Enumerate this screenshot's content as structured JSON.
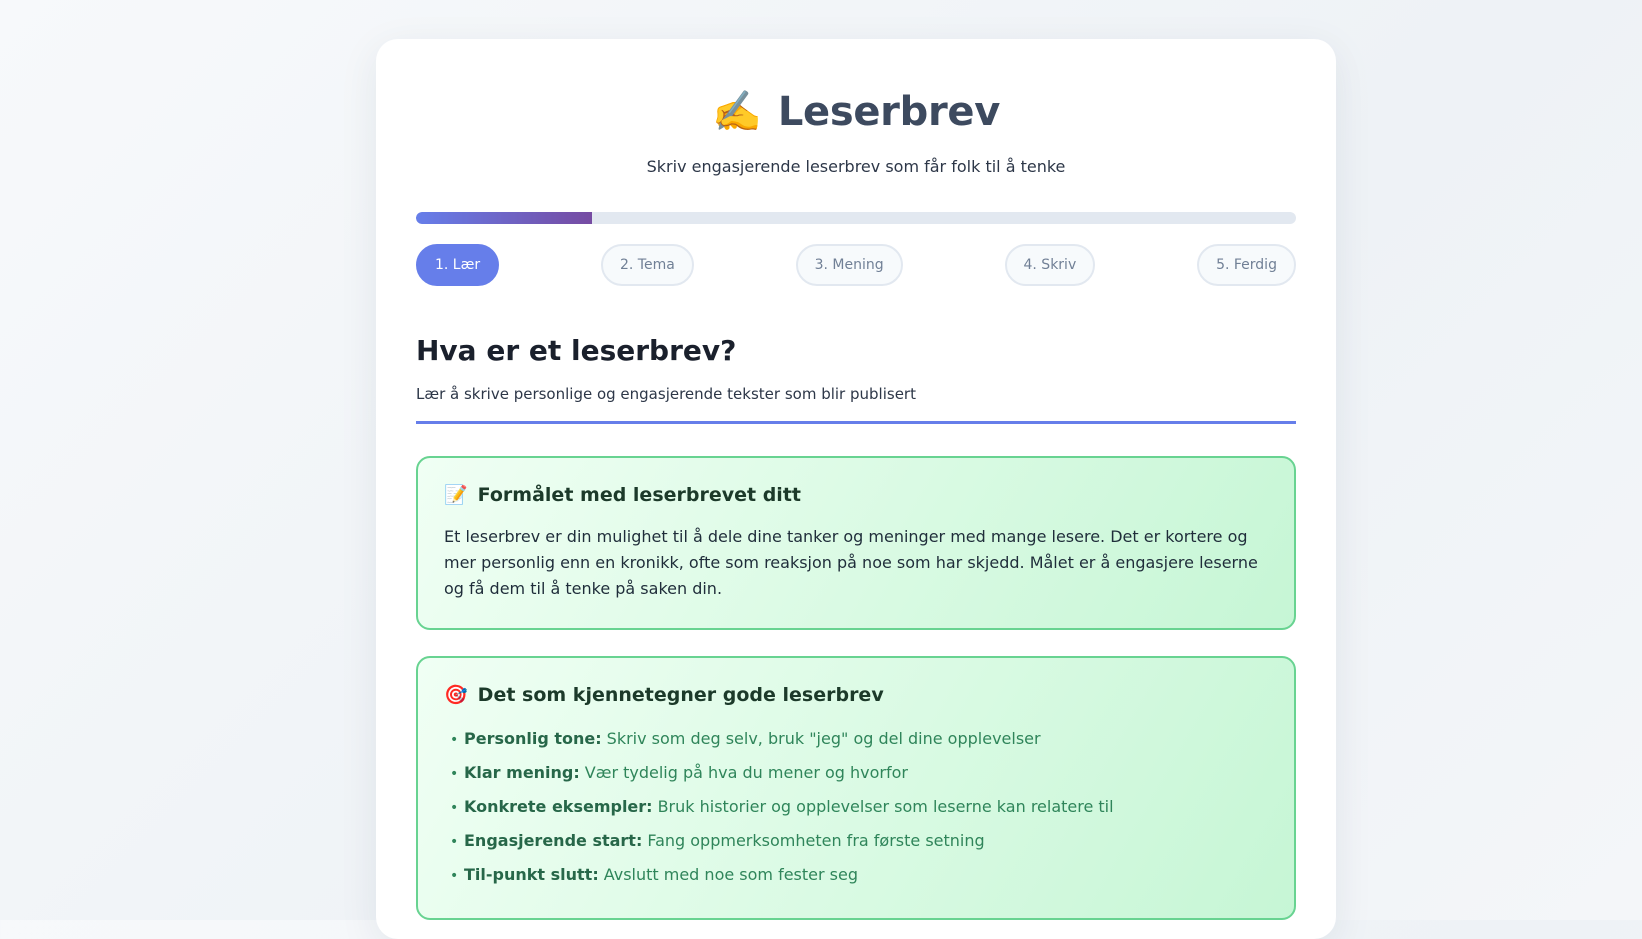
{
  "header": {
    "icon": "writing-hand-emoji",
    "icon_glyph": "✍️",
    "title": "Leserbrev",
    "subtitle": "Skriv engasjerende leserbrev som får folk til å tenke"
  },
  "progress": {
    "fraction": 0.2
  },
  "steps": [
    {
      "label": "1. Lær",
      "active": true
    },
    {
      "label": "2. Tema",
      "active": false
    },
    {
      "label": "3. Mening",
      "active": false
    },
    {
      "label": "4. Skriv",
      "active": false
    },
    {
      "label": "5. Ferdig",
      "active": false
    }
  ],
  "section": {
    "title": "Hva er et leserbrev?",
    "subtitle": "Lær å skrive personlige og engasjerende tekster som blir publisert"
  },
  "purpose_box": {
    "icon": "memo-icon",
    "icon_glyph": "📝",
    "title": "Formålet med leserbrevet ditt",
    "text": "Et leserbrev er din mulighet til å dele dine tanker og meninger med mange lesere. Det er kortere og mer personlig enn en kronikk, ofte som reaksjon på noe som har skjedd. Målet er å engasjere leserne og få dem til å tenke på saken din."
  },
  "features_box": {
    "icon": "target-icon",
    "icon_glyph": "🎯",
    "title": "Det som kjennetegner gode leserbrev",
    "items": [
      {
        "name": "Personlig tone:",
        "desc": "Skriv som deg selv, bruk \"jeg\" og del dine opplevelser"
      },
      {
        "name": "Klar mening:",
        "desc": "Vær tydelig på hva du mener og hvorfor"
      },
      {
        "name": "Konkrete eksempler:",
        "desc": "Bruk historier og opplevelser som leserne kan relatere til"
      },
      {
        "name": "Engasjerende start:",
        "desc": "Fang oppmerksomheten fra første setning"
      },
      {
        "name": "Til-punkt slutt:",
        "desc": "Avslutt med noe som fester seg"
      }
    ]
  },
  "colors": {
    "accent": "#667eea",
    "accent_end": "#764ba2",
    "box_border": "#68d391",
    "feature_text": "#2f855a"
  }
}
